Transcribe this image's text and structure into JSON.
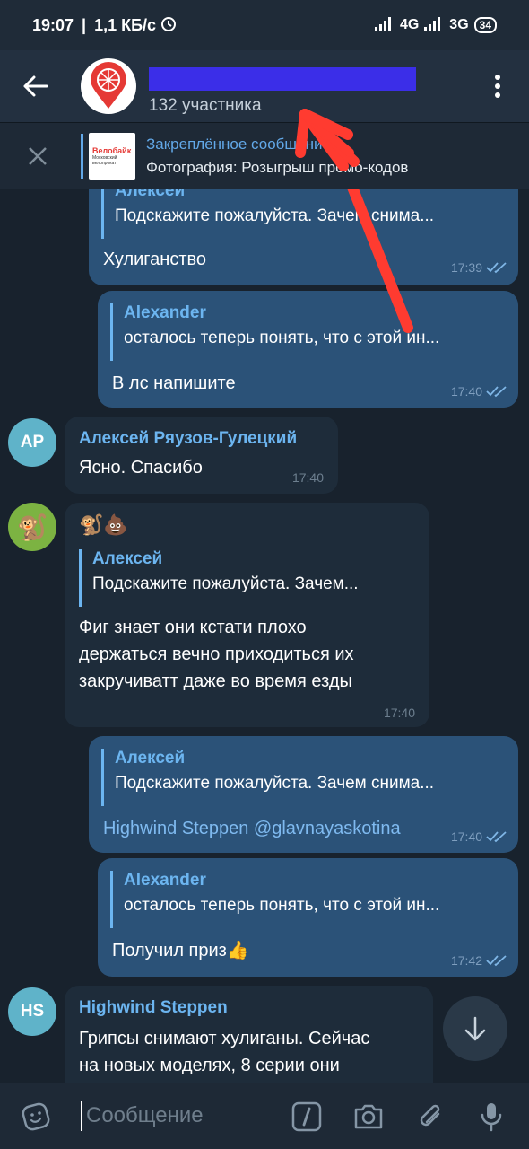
{
  "status": {
    "time": "19:07",
    "net_speed": "1,1 КБ/с",
    "net1": "4G",
    "net2": "3G",
    "battery": "34"
  },
  "header": {
    "subtitle": "132 участника"
  },
  "pinned": {
    "title": "Закреплённое сообщение",
    "text": "Фотография: Розыгрыш промо-кодов",
    "thumb_title": "Велобайк",
    "thumb_sub": "Московский велопрокат"
  },
  "messages": [
    {
      "reply_name": "Алексей",
      "reply_text": "Подскажите пожалуйста. Зачем снима...",
      "text": "Хулиганство",
      "time": "17:39"
    },
    {
      "reply_name": "Alexander",
      "reply_text": "осталось теперь понять, что с этой ин...",
      "text": "В лс напишите",
      "time": "17:40"
    },
    {
      "avatar": "АР",
      "sender": "Алексей Ряузов-Гулецкий",
      "text": "Ясно. Спасибо",
      "time": "17:40"
    },
    {
      "sender_emoji": "🐒💩",
      "reply_name": "Алексей",
      "reply_text": "Подскажите пожалуйста. Зачем...",
      "text_lines": [
        "Фиг знает они кстати плохо",
        "держаться вечно приходиться их",
        "закручиватт даже во время езды"
      ],
      "time": "17:40"
    },
    {
      "reply_name": "Алексей",
      "reply_text": "Подскажите пожалуйста. Зачем снима...",
      "text": "Highwind Steppen @glavnayaskotina",
      "time": "17:40"
    },
    {
      "reply_name": "Alexander",
      "reply_text": "осталось теперь понять, что с этой ин...",
      "text": "Получил приз👍",
      "time": "17:42"
    },
    {
      "avatar": "HS",
      "sender": "Highwind Steppen",
      "text_lines": [
        "Грипсы снимают хулиганы.  Сейчас",
        "на новых моделях, 8 серии они"
      ]
    }
  ],
  "input": {
    "placeholder": "Сообщение"
  },
  "colors": {
    "accent": "#6cb5f0",
    "outgoing_bubble": "#2b5278",
    "incoming_bubble": "#1e2c3a",
    "avatar_ar": "#5fb3c9",
    "avatar_hs": "#5fb3c9",
    "annotation_arrow": "#ff3b30"
  }
}
